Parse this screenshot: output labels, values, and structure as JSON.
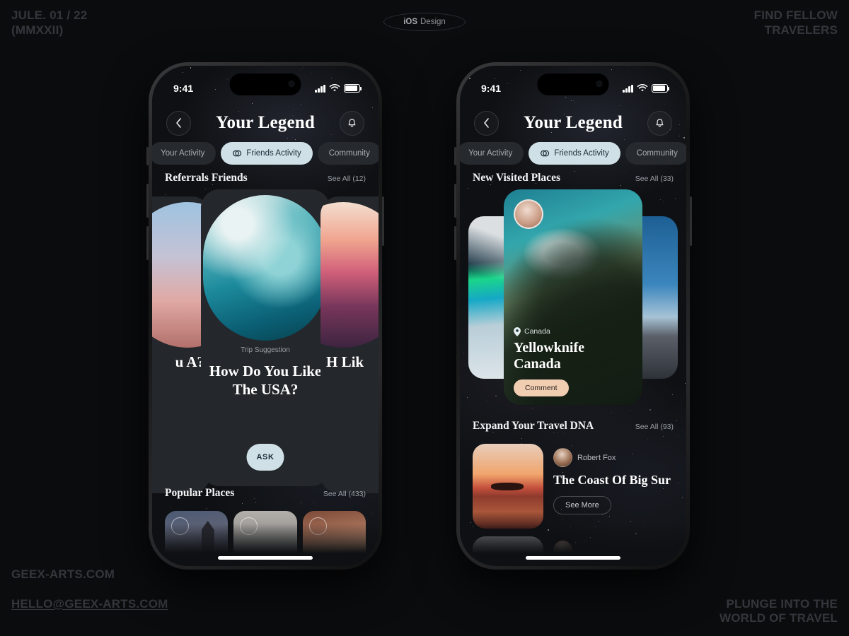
{
  "poster": {
    "top_left": "JULE. 01 / 22\n(MMXXII)",
    "badge_bold": "iOS",
    "badge_rest": " Design",
    "top_right": "FIND FELLOW\nTRAVELERS",
    "bottom_left_line1": "GEEX-ARTS.COM",
    "bottom_left_line2": "HELLO@GEEX-ARTS.COM",
    "bottom_right": "PLUNGE INTO THE\nWORLD OF TRAVEL",
    "accent_light": "#cfe1e6",
    "accent_peach": "#f1cdb2",
    "background": "#0b0c0e"
  },
  "status_bar": {
    "time": "9:41"
  },
  "nav": {
    "back_icon": "chevron-left-icon",
    "title": "Your Legend",
    "bell_icon": "bell-icon"
  },
  "tabs": [
    {
      "label": "Your Activity",
      "active": false
    },
    {
      "label": "Friends Activity",
      "active": true,
      "icon": "friends-circles-icon"
    },
    {
      "label": "Community",
      "active": false
    }
  ],
  "phone_left": {
    "section1": {
      "title": "Referrals Friends",
      "see_all": "See All (12)"
    },
    "card_prev": {
      "title_fragment": "u\nA?"
    },
    "card_main": {
      "kicker": "Trip Suggestion",
      "title": "How Do You Like The USA?",
      "button": "ASK"
    },
    "card_next": {
      "title_fragment": "H\nLik"
    },
    "section2": {
      "title": "Popular Places",
      "see_all": "See All (433)"
    },
    "thumbs": [
      {
        "name": "big-ben"
      },
      {
        "name": "grey-landscape"
      },
      {
        "name": "red-canyon"
      }
    ]
  },
  "phone_right": {
    "section1": {
      "title": "New Visited Places",
      "see_all": "See All (33)"
    },
    "featured": {
      "location_icon": "location-pin-icon",
      "location": "Canada",
      "title": "Yellowknife\nCanada",
      "button": "Comment"
    },
    "section2": {
      "title": "Expand Your Travel DNA",
      "see_all": "See All (93)"
    },
    "article": {
      "author": "Robert Fox",
      "title": "The Coast Of Big Sur",
      "button": "See More"
    }
  }
}
